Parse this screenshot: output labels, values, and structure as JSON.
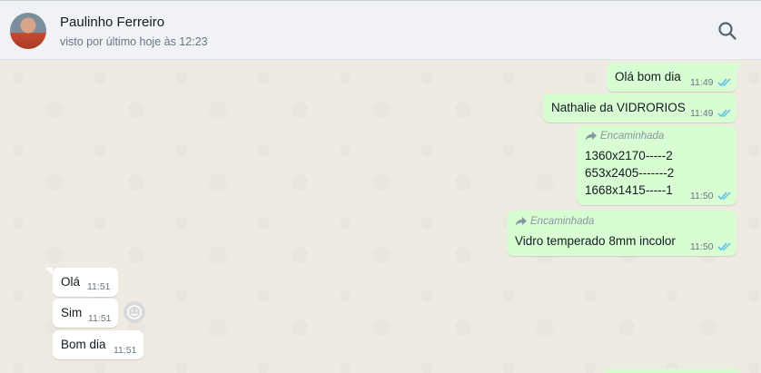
{
  "header": {
    "contact_name": "Paulinho Ferreiro",
    "status": "visto por último hoje às 12:23",
    "search_icon": "search-icon"
  },
  "messages": {
    "m1": {
      "text": "Olá bom dia",
      "time": "11:49",
      "direction": "out",
      "status": "read"
    },
    "m2": {
      "text": "Nathalie da VIDRORIOS",
      "time": "11:49",
      "direction": "out",
      "status": "read"
    },
    "m3": {
      "forwarded_label": "Encaminhada",
      "lines": [
        "1360x2170-----2",
        "653x2405-------2",
        "1668x1415-----1"
      ],
      "time": "11:50",
      "direction": "out",
      "status": "read"
    },
    "m4": {
      "forwarded_label": "Encaminhada",
      "text": "Vidro temperado 8mm incolor",
      "time": "11:50",
      "direction": "out",
      "status": "read"
    },
    "m5": {
      "text": "Olá",
      "time": "11:51",
      "direction": "in"
    },
    "m6": {
      "text": "Sim",
      "time": "11:51",
      "direction": "in"
    },
    "m7": {
      "text": "Bom dia",
      "time": "11:51",
      "direction": "in"
    }
  },
  "colors": {
    "outgoing_bubble": "#d9fdd3",
    "incoming_bubble": "#ffffff",
    "read_ticks": "#53bdeb",
    "chat_background": "#efeae2",
    "header_background": "#f0f2f5"
  }
}
